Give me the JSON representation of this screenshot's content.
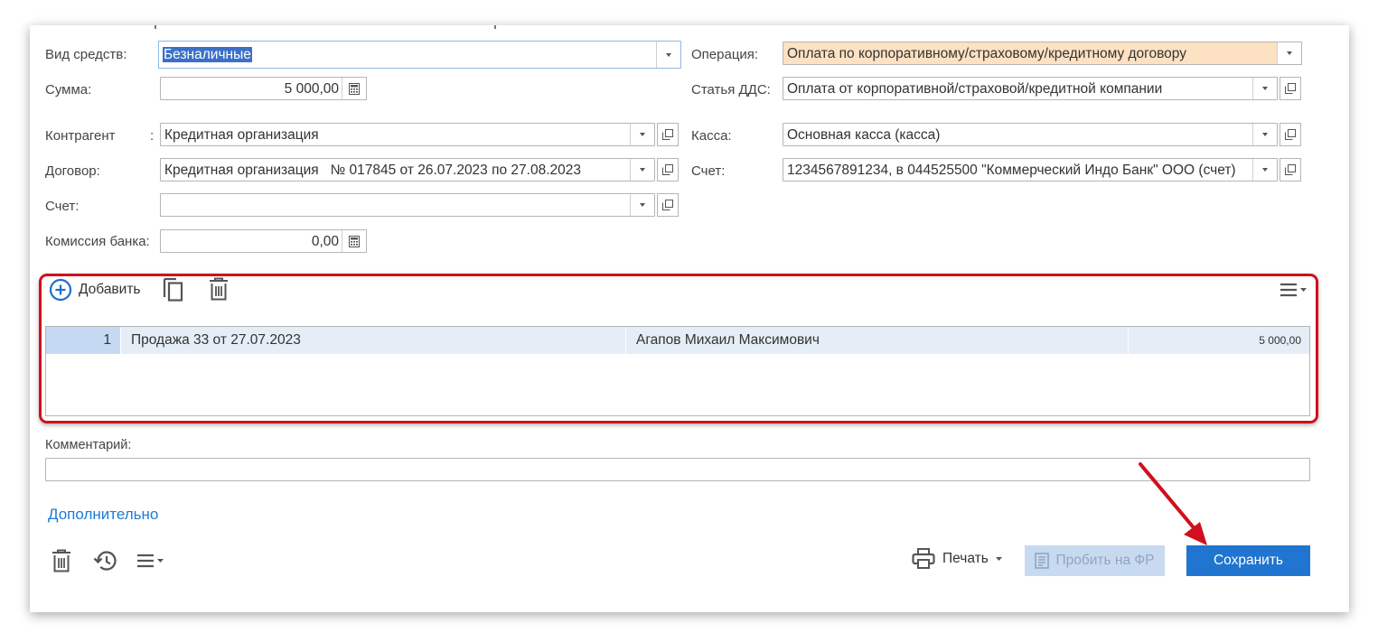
{
  "form": {
    "vid_sredstv": {
      "label": "Вид средств:",
      "value": "Безналичные"
    },
    "summa": {
      "label": "Сумма:",
      "value": "5 000,00"
    },
    "kontragent": {
      "label": "Контрагент",
      "colon": ":",
      "value": "Кредитная организация"
    },
    "dogovor": {
      "label": "Договор:",
      "value": "Кредитная организация   № 017845 от 26.07.2023 по 27.08.2023"
    },
    "schet_left": {
      "label": "Счет:",
      "value": ""
    },
    "komissiya": {
      "label": "Комиссия банка:",
      "value": "0,00"
    },
    "operaciya": {
      "label": "Операция:",
      "value": "Оплата по корпоративному/страховому/кредитному договору"
    },
    "statya": {
      "label": "Статья ДДС:",
      "value": "Оплата от корпоративной/страховой/кредитной компании"
    },
    "kassa": {
      "label": "Касса:",
      "value": "Основная касса (касса)"
    },
    "schet_right": {
      "label": "Счет:",
      "value": "1234567891234, в 044525500 \"Коммерческий Индо Банк\" ООО (счет)"
    }
  },
  "table_toolbar": {
    "add_label": "Добавить"
  },
  "table": {
    "rows": [
      {
        "num": "1",
        "doc": "Продажа 33 от 27.07.2023",
        "person": "Агапов Михаил Максимович",
        "amount": "5 000,00"
      }
    ]
  },
  "comment": {
    "label": "Комментарий:",
    "value": ""
  },
  "more_link": "Дополнительно",
  "footer": {
    "print_label": "Печать",
    "fiscal_label": "Пробить на ФР",
    "save_label": "Сохранить"
  },
  "colors": {
    "accent": "#1f75cf",
    "highlight_frame": "#d0101d",
    "operation_bg": "#fde1c3",
    "selection": "#3b70c8"
  }
}
